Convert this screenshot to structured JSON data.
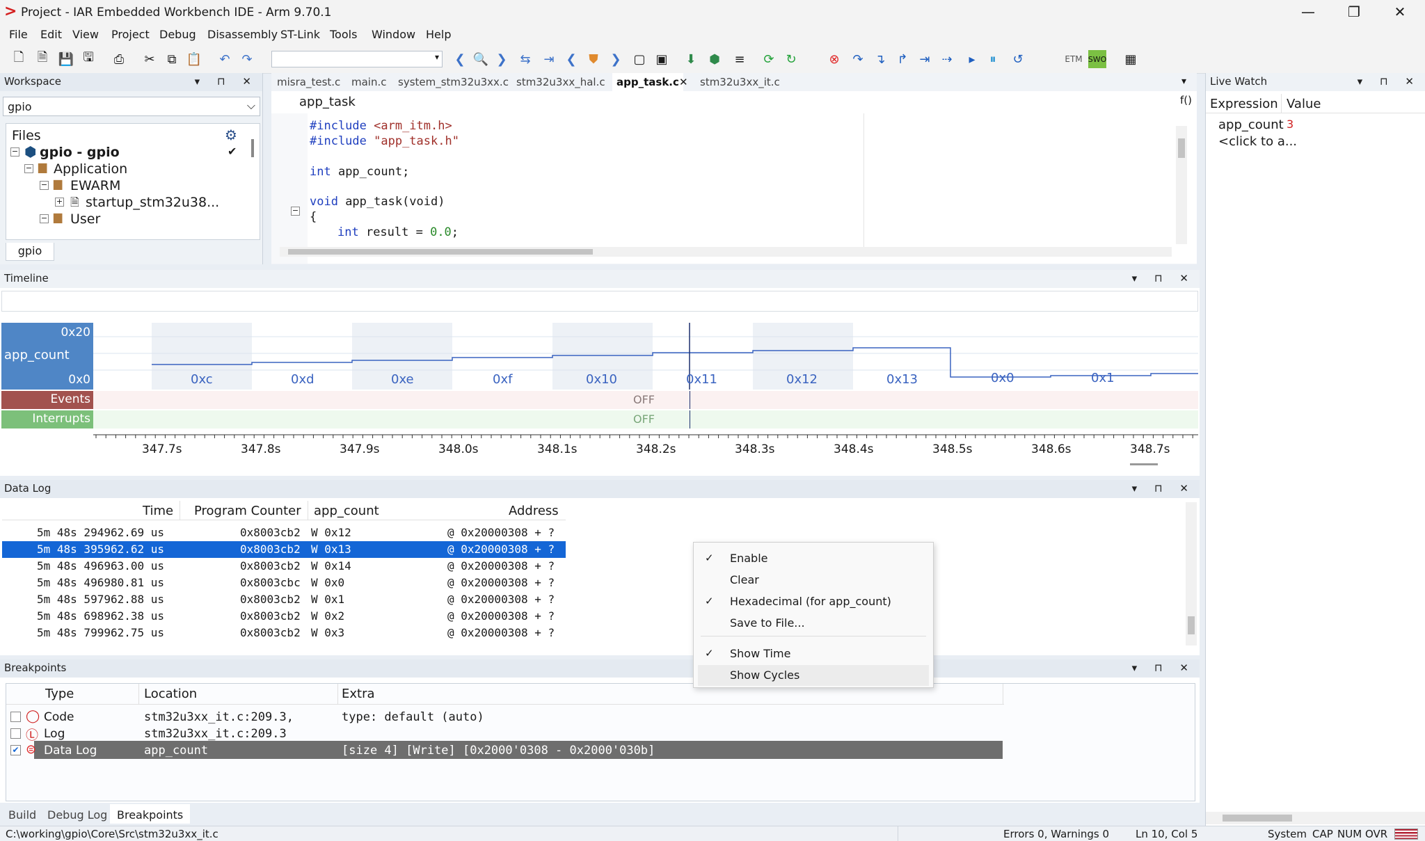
{
  "window": {
    "title": "Project - IAR Embedded Workbench IDE - Arm 9.70.1",
    "minimize": "—",
    "restore": "❐",
    "close": "✕"
  },
  "menu": [
    "File",
    "Edit",
    "View",
    "Project",
    "Debug",
    "Disassembly",
    "ST-Link",
    "Tools",
    "Window",
    "Help"
  ],
  "workspace": {
    "title": "Workspace",
    "config": "gpio",
    "files_header": "Files",
    "tree": [
      {
        "label": "gpio - gpio",
        "depth": 0,
        "bold": true
      },
      {
        "label": "Application",
        "depth": 1
      },
      {
        "label": "EWARM",
        "depth": 2
      },
      {
        "label": "startup_stm32u38...",
        "depth": 3
      },
      {
        "label": "User",
        "depth": 2
      }
    ],
    "bottom_tab": "gpio"
  },
  "editor": {
    "tabs": [
      "misra_test.c",
      "main.c",
      "system_stm32u3xx.c",
      "stm32u3xx_hal.c",
      "app_task.c",
      "stm32u3xx_it.c"
    ],
    "active_tab": "app_task.c",
    "function": "app_task",
    "func_icon": "f()",
    "code": [
      {
        "kw": "#include",
        "rest": " <arm_itm.h>",
        "type": "inc"
      },
      {
        "kw": "#include",
        "rest": " \"app_task.h\"",
        "type": "inc"
      },
      {
        "kw": "",
        "rest": "",
        "type": "blank"
      },
      {
        "kw": "int",
        "rest": " app_count;",
        "type": "decl"
      },
      {
        "kw": "",
        "rest": "",
        "type": "blank"
      },
      {
        "kw": "void",
        "rest": " app_task(void)",
        "type": "decl"
      },
      {
        "kw": "",
        "rest": "{",
        "type": "plain"
      },
      {
        "kw": "int",
        "rest": " result = ",
        "num": "0.0",
        "tail": ";",
        "type": "declnum",
        "indent": true
      }
    ]
  },
  "livewatch": {
    "title": "Live Watch",
    "col_expr": "Expression",
    "col_value": "Value",
    "rows": [
      {
        "expr": "app_count",
        "value": "3"
      },
      {
        "expr": "<click to a...",
        "value": ""
      }
    ]
  },
  "timeline": {
    "title": "Timeline",
    "signal": "app_count",
    "y_max": "0x20",
    "y_min": "0x0",
    "value_labels": [
      "0xc",
      "0xd",
      "0xe",
      "0xf",
      "0x10",
      "0x11",
      "0x12",
      "0x13",
      "0x0",
      "0x1"
    ],
    "events_label": "Events",
    "events_state": "OFF",
    "interrupts_label": "Interrupts",
    "interrupts_state": "OFF",
    "time_ticks": [
      "347.7s",
      "347.8s",
      "347.9s",
      "348.0s",
      "348.1s",
      "348.2s",
      "348.3s",
      "348.4s",
      "348.5s",
      "348.6s",
      "348.7s"
    ]
  },
  "datalog": {
    "title": "Data Log",
    "columns": [
      "Time",
      "Program Counter",
      "app_count",
      "Address"
    ],
    "rows": [
      {
        "time": "5m 48s 294962.69 us",
        "pc": "0x8003cb2",
        "val": "W 0x12",
        "addr": "@ 0x20000308 + ?"
      },
      {
        "time": "5m 48s 395962.62 us",
        "pc": "0x8003cb2",
        "val": "W 0x13",
        "addr": "@ 0x20000308 + ?",
        "selected": true
      },
      {
        "time": "5m 48s 496963.00 us",
        "pc": "0x8003cb2",
        "val": "W 0x14",
        "addr": "@ 0x20000308 + ?"
      },
      {
        "time": "5m 48s 496980.81 us",
        "pc": "0x8003cbc",
        "val": "W 0x0",
        "addr": "@ 0x20000308 + ?"
      },
      {
        "time": "5m 48s 597962.88 us",
        "pc": "0x8003cb2",
        "val": "W 0x1",
        "addr": "@ 0x20000308 + ?"
      },
      {
        "time": "5m 48s 698962.38 us",
        "pc": "0x8003cb2",
        "val": "W 0x2",
        "addr": "@ 0x20000308 + ?"
      },
      {
        "time": "5m 48s 799962.75 us",
        "pc": "0x8003cb2",
        "val": "W 0x3",
        "addr": "@ 0x20000308 + ?"
      }
    ]
  },
  "context_menu": [
    {
      "label": "Enable",
      "checked": true
    },
    {
      "label": "Clear",
      "checked": false
    },
    {
      "label": "Hexadecimal (for app_count)",
      "checked": true
    },
    {
      "label": "Save to File...",
      "checked": false
    },
    {
      "label": "Show Time",
      "checked": true,
      "separator_before": true
    },
    {
      "label": "Show Cycles",
      "checked": false,
      "hover": true
    }
  ],
  "breakpoints": {
    "title": "Breakpoints",
    "columns": [
      "Type",
      "Location",
      "Extra"
    ],
    "rows": [
      {
        "type": "Code",
        "location": "stm32u3xx_it.c:209.3,",
        "extra": "type: default (auto)",
        "checked": false
      },
      {
        "type": "Log",
        "location": "stm32u3xx_it.c:209.3",
        "extra": "",
        "checked": false
      },
      {
        "type": "Data Log",
        "location": "app_count",
        "extra": "[size 4] [Write] [0x2000'0308 - 0x2000'030b]",
        "checked": true,
        "selected": true
      }
    ],
    "bottom_tabs": [
      "Build",
      "Debug Log",
      "Breakpoints"
    ],
    "active_bottom_tab": "Breakpoints"
  },
  "statusbar": {
    "path": "C:\\working\\gpio\\Core\\Src\\stm32u3xx_it.c",
    "errors": "Errors 0, Warnings 0",
    "position": "Ln 10, Col 5",
    "system": "System",
    "caps": "CAP",
    "num": "NUM",
    "ovr": "OVR"
  },
  "colors": {
    "accent": "#1466d6",
    "events_bar": "#a2524e",
    "interrupts_bar": "#7cc07a",
    "signal_bar": "#4f86c6",
    "keyword": "#1f3fbf",
    "string": "#a0302a",
    "number": "#2a8a2a"
  }
}
